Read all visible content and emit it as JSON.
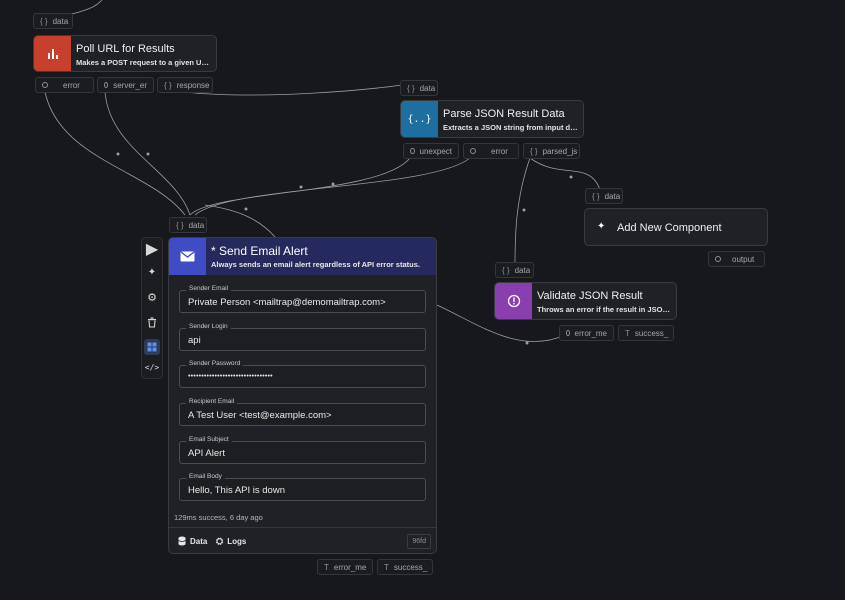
{
  "colors": {
    "poll_icon_bg": "#c7402e",
    "parse_icon_bg": "#1e6fa0",
    "validate_icon_bg": "#8a3fb1",
    "email_header_bg": "#252a5e",
    "email_icon_bg": "#3f4cc4",
    "canvas_bg": "#17181b"
  },
  "poll": {
    "input_chip": "data",
    "title": "Poll URL for Results",
    "desc": "Makes a POST request to a given UR...",
    "outputs": [
      "error",
      "server_er",
      "response"
    ]
  },
  "parse": {
    "input_chip": "data",
    "title": "Parse JSON Result Data",
    "desc": "Extracts a JSON string from input dat...",
    "outputs": [
      "unexpect",
      "error",
      "parsed_js"
    ]
  },
  "add_component": {
    "input_chip": "data",
    "title": "Add New Component",
    "output_chip": "output"
  },
  "validate": {
    "input_chip": "data",
    "title": "Validate JSON Result",
    "desc": "Throws an error if the result in JSON i...",
    "outputs": [
      "error_me",
      "success_"
    ]
  },
  "email": {
    "input_chip": "data",
    "title": "* Send Email Alert",
    "desc": "Always sends an email alert regardless of API error status.",
    "fields": [
      {
        "label": "Sender Email",
        "value": "Private Person <mailtrap@demomailtrap.com>"
      },
      {
        "label": "Sender Login",
        "value": "api"
      },
      {
        "label": "Sender Password",
        "value": "••••••••••••••••••••••••••••••••"
      },
      {
        "label": "Recipient Email",
        "value": "A Test User <test@example.com>"
      },
      {
        "label": "Email Subject",
        "value": "API Alert"
      },
      {
        "label": "Email Body",
        "value": "Hello, This API is down"
      }
    ],
    "status": "129ms success, 6 day ago",
    "data_btn": "Data",
    "logs_btn": "Logs",
    "id_badge": "96fd",
    "outputs": [
      "error_me",
      "success_"
    ]
  }
}
